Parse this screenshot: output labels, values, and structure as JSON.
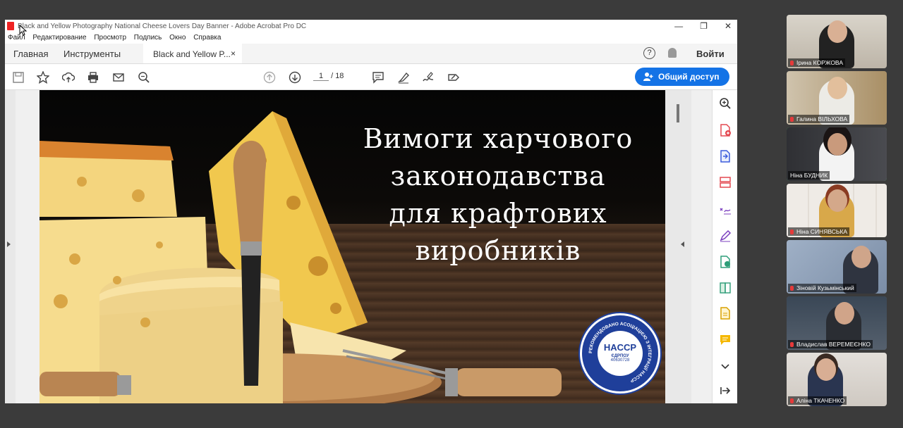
{
  "window": {
    "title": "Black and Yellow Photography National Cheese Lovers Day Banner - Adobe Acrobat Pro DC",
    "controls": [
      "—",
      "❐",
      "✕"
    ]
  },
  "menu": [
    "Файл",
    "Редактирование",
    "Просмотр",
    "Подпись",
    "Окно",
    "Справка"
  ],
  "tabs": {
    "home": "Главная",
    "tools": "Инструменты",
    "document": "Black and Yellow P...",
    "close": "×",
    "help": "?",
    "login": "Войти"
  },
  "toolbar": {
    "page_current": "1",
    "page_separator": "/",
    "page_total": "18",
    "share_label": "Общий доступ"
  },
  "slide": {
    "title_lines": [
      "Вимоги харчового",
      "законодавства",
      "для крафтових",
      "виробників"
    ],
    "badge": {
      "brand": "HACCP",
      "edrpou_label": "ЄДРПОУ",
      "edrpou_number": "40630728",
      "ring_text": "РЕКОМЕНДОВАНО АСОЦІАЦІЄЮ З ІНТЕГРАЦІЇ HACCP"
    }
  },
  "participants": [
    {
      "name": "Ірина КОРЖОВА",
      "bg": "#c9c3b7",
      "clothes": "#222222"
    },
    {
      "name": "Галина ВІЛЬХОВА",
      "bg": "#b8a58a",
      "clothes": "#e8e6e1"
    },
    {
      "name": "Ніна БУДНИК",
      "bg": "#3a3b3f",
      "clothes": "#f1f1f1",
      "active": true
    },
    {
      "name": "Ніна СИНЯВСЬКА",
      "bg": "#e9e6e2",
      "clothes": "#d8a84a"
    },
    {
      "name": "Зіновій Кузьмінський",
      "bg": "#8fa0b8",
      "clothes": "#2f3440"
    },
    {
      "name": "Владислав ВЕРЕМЕЄНКО",
      "bg": "#44505e",
      "clothes": "#2a2d33"
    },
    {
      "name": "Аліна ТКАЧЕНКО",
      "bg": "#d9d4cf",
      "clothes": "#2a3550"
    }
  ],
  "colors": {
    "accent": "#1473e6",
    "active_speaker": "#3fcf6d",
    "badge_blue": "#1f3f9a"
  }
}
